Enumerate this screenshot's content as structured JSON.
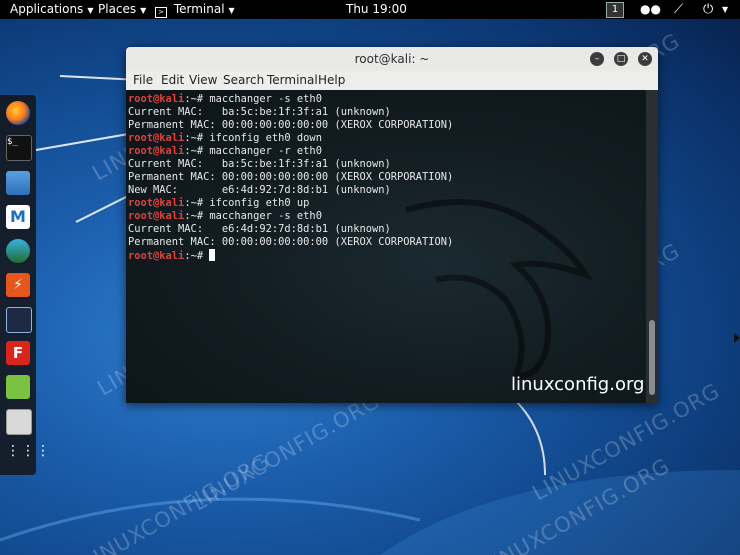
{
  "topbar": {
    "applications": "Applications",
    "places": "Places",
    "terminal": "Terminal",
    "clock": "Thu 19:00",
    "workspace": "1"
  },
  "window": {
    "title": "root@kali: ~",
    "menu": [
      "File",
      "Edit",
      "View",
      "Search",
      "Terminal",
      "Help"
    ]
  },
  "terminal": {
    "lines": [
      {
        "prompt": "root@kali",
        "suffix": ":~# ",
        "text": "macchanger -s eth0"
      },
      {
        "prompt": "",
        "suffix": "",
        "text": "Current MAC:   ba:5c:be:1f:3f:a1 (unknown)"
      },
      {
        "prompt": "",
        "suffix": "",
        "text": "Permanent MAC: 00:00:00:00:00:00 (XEROX CORPORATION)"
      },
      {
        "prompt": "root@kali",
        "suffix": ":~# ",
        "text": "ifconfig eth0 down"
      },
      {
        "prompt": "root@kali",
        "suffix": ":~# ",
        "text": "macchanger -r eth0"
      },
      {
        "prompt": "",
        "suffix": "",
        "text": "Current MAC:   ba:5c:be:1f:3f:a1 (unknown)"
      },
      {
        "prompt": "",
        "suffix": "",
        "text": "Permanent MAC: 00:00:00:00:00:00 (XEROX CORPORATION)"
      },
      {
        "prompt": "",
        "suffix": "",
        "text": "New MAC:       e6:4d:92:7d:8d:b1 (unknown)"
      },
      {
        "prompt": "root@kali",
        "suffix": ":~# ",
        "text": "ifconfig eth0 up"
      },
      {
        "prompt": "root@kali",
        "suffix": ":~# ",
        "text": "macchanger -s eth0"
      },
      {
        "prompt": "",
        "suffix": "",
        "text": "Current MAC:   e6:4d:92:7d:8d:b1 (unknown)"
      },
      {
        "prompt": "",
        "suffix": "",
        "text": "Permanent MAC: 00:00:00:00:00:00 (XEROX CORPORATION)"
      },
      {
        "prompt": "root@kali",
        "suffix": ":~# ",
        "text": "",
        "cursor": true
      }
    ]
  },
  "watermark": "LINUXCONFIG.ORG",
  "brand": "linuxconfig.org",
  "dock_icons": [
    "firefox-icon",
    "terminal-icon",
    "files-icon",
    "metasploit-icon",
    "armitage-icon",
    "burpsuite-icon",
    "maltego-icon",
    "faraday-icon",
    "leafpad-icon",
    "cherrytree-icon",
    "show-apps-icon"
  ],
  "colors": {
    "prompt": "#e0413a",
    "desktop": "#1c5fae"
  }
}
